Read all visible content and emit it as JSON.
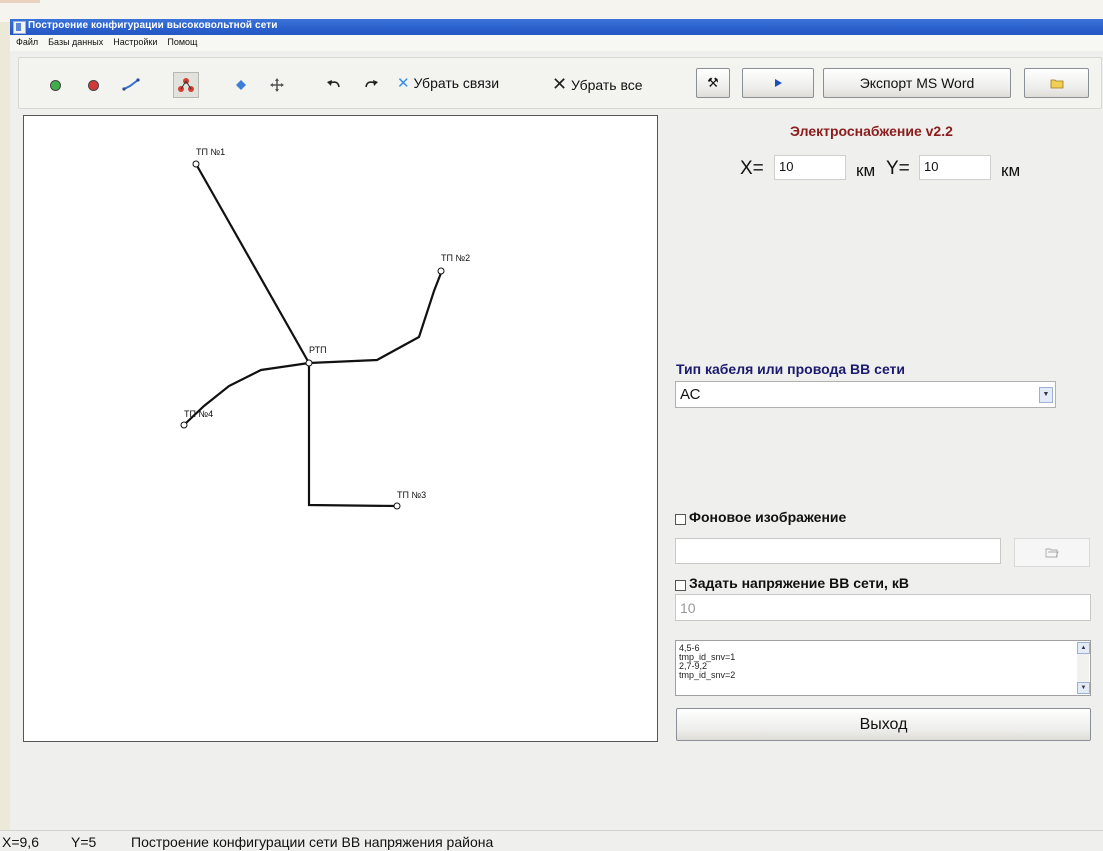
{
  "window": {
    "title": "Построение конфигурации высоковольтной сети"
  },
  "menu": [
    "Файл",
    "Базы данных",
    "Настройки",
    "Помощ"
  ],
  "toolbar": {
    "remove_links_label": "Убрать связи",
    "remove_all_label": "Убрать все",
    "export_label": "Экспорт MS Word"
  },
  "canvas": {
    "nodes": [
      {
        "id": "tp1",
        "label": "ТП №1"
      },
      {
        "id": "tp2",
        "label": "ТП №2"
      },
      {
        "id": "rtp",
        "label": "РТП"
      },
      {
        "id": "tp4",
        "label": "ТП №4"
      },
      {
        "id": "tp3",
        "label": "ТП №3"
      }
    ]
  },
  "panel": {
    "app_title": "Электроснабжение v2.2",
    "x_label": "X=",
    "x_value": "10",
    "x_unit": "км",
    "y_label": "Y=",
    "y_value": "10",
    "y_unit": "км",
    "cable_type_label": "Тип кабеля или провода ВВ сети",
    "cable_type_value": "АС",
    "background_label": "Фоновое изображение",
    "background_path": "",
    "voltage_label": "Задать напряжение ВВ сети, кВ",
    "voltage_value": "10",
    "log_lines": [
      "4,5-6",
      "tmp_id_snv=1",
      "2,7-9,2",
      "tmp_id_snv=2"
    ],
    "exit_label": "Выход"
  },
  "status": {
    "x": "X=9,6",
    "y": "Y=5",
    "message": "Построение конфигурации сети ВВ напряжения района"
  },
  "colors": {
    "title_bar": "#2a5fcc",
    "app_title": "#8a1c1c",
    "section_label": "#1a1a6e"
  }
}
